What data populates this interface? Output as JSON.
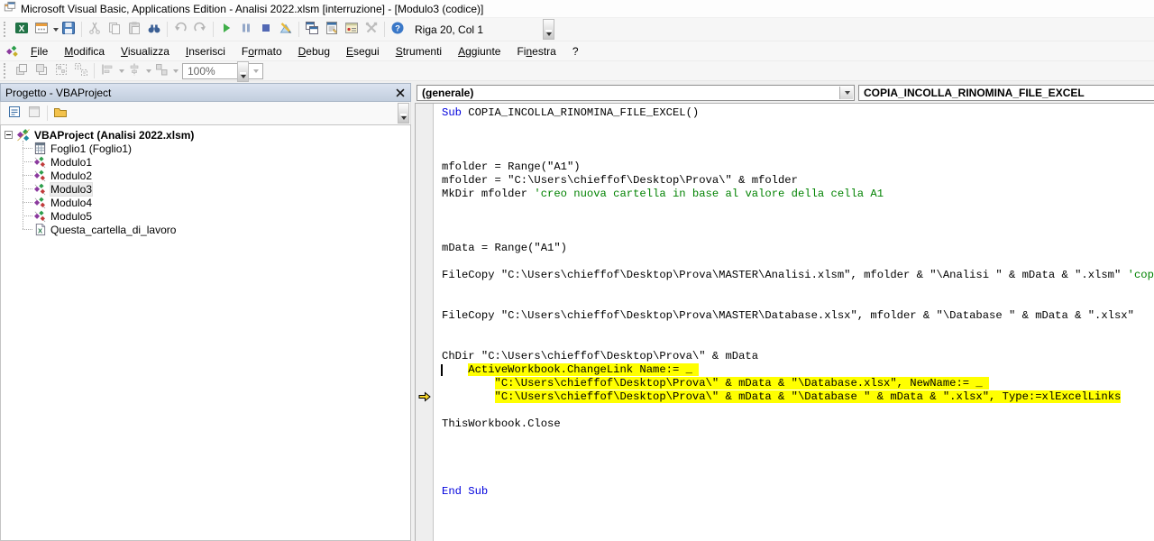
{
  "window": {
    "title": "Microsoft Visual Basic, Applications Edition - Analisi 2022.xlsm [interruzione] - [Modulo3 (codice)]"
  },
  "toolbar_main": {
    "position_status": "Riga 20, Col 1",
    "buttons": [
      {
        "name": "view-excel-button",
        "icon": "excel",
        "enabled": true
      },
      {
        "name": "insert-userform-button",
        "icon": "userform",
        "enabled": true,
        "dropdown": true
      },
      {
        "name": "save-button",
        "icon": "save",
        "enabled": true
      },
      {
        "sep": true
      },
      {
        "name": "cut-button",
        "icon": "cut",
        "enabled": false
      },
      {
        "name": "copy-button",
        "icon": "copy",
        "enabled": false
      },
      {
        "name": "paste-button",
        "icon": "paste",
        "enabled": false
      },
      {
        "name": "find-button",
        "icon": "find",
        "enabled": true
      },
      {
        "sep": true
      },
      {
        "name": "undo-button",
        "icon": "undo",
        "enabled": false
      },
      {
        "name": "redo-button",
        "icon": "redo",
        "enabled": false
      },
      {
        "sep": true
      },
      {
        "name": "run-button",
        "icon": "run",
        "enabled": true
      },
      {
        "name": "break-button",
        "icon": "pause",
        "enabled": true
      },
      {
        "name": "reset-button",
        "icon": "stop",
        "enabled": true
      },
      {
        "name": "design-mode-button",
        "icon": "design",
        "enabled": true
      },
      {
        "sep": true
      },
      {
        "name": "project-explorer-button",
        "icon": "projexp",
        "enabled": true
      },
      {
        "name": "properties-window-button",
        "icon": "props",
        "enabled": true
      },
      {
        "name": "object-browser-button",
        "icon": "objbrowser",
        "enabled": true
      },
      {
        "name": "toolbox-button",
        "icon": "toolbox",
        "enabled": false
      },
      {
        "sep": true
      },
      {
        "name": "help-button",
        "icon": "help",
        "enabled": true
      }
    ]
  },
  "menubar": {
    "items": [
      {
        "label": "File",
        "accel": 0
      },
      {
        "label": "Modifica",
        "accel": 0
      },
      {
        "label": "Visualizza",
        "accel": 0
      },
      {
        "label": "Inserisci",
        "accel": 0
      },
      {
        "label": "Formato",
        "accel": 1
      },
      {
        "label": "Debug",
        "accel": 0
      },
      {
        "label": "Esegui",
        "accel": 0
      },
      {
        "label": "Strumenti",
        "accel": 0
      },
      {
        "label": "Aggiunte",
        "accel": 0
      },
      {
        "label": "Finestra",
        "accel": 2
      },
      {
        "label": "?",
        "accel": -1
      }
    ]
  },
  "toolbar_userform": {
    "zoom_value": "100%",
    "buttons": [
      {
        "name": "bring-to-front-button",
        "icon": "bringfront",
        "enabled": false
      },
      {
        "name": "send-to-back-button",
        "icon": "sendback",
        "enabled": false
      },
      {
        "name": "group-button",
        "icon": "group",
        "enabled": false
      },
      {
        "name": "ungroup-button",
        "icon": "ungroup",
        "enabled": false
      },
      {
        "sep": true
      },
      {
        "name": "align-button",
        "icon": "align",
        "enabled": false,
        "dropdown": true
      },
      {
        "name": "center-button",
        "icon": "centerh",
        "enabled": false,
        "dropdown": true
      },
      {
        "name": "make-same-size-button",
        "icon": "samesize",
        "enabled": false,
        "dropdown": true
      }
    ]
  },
  "project_panel": {
    "title": "Progetto - VBAProject",
    "toolbar": [
      {
        "name": "view-code-button",
        "icon": "viewcode",
        "enabled": true
      },
      {
        "name": "view-object-button",
        "icon": "viewobject",
        "enabled": false
      },
      {
        "sep": true
      },
      {
        "name": "toggle-folders-button",
        "icon": "folder",
        "enabled": true
      }
    ],
    "tree": {
      "root": {
        "label": "VBAProject (Analisi 2022.xlsm)",
        "icon": "vbaproj",
        "expanded": true
      },
      "children": [
        {
          "label": "Foglio1 (Foglio1)",
          "icon": "worksheet",
          "selected": false
        },
        {
          "label": "Modulo1",
          "icon": "module",
          "selected": false
        },
        {
          "label": "Modulo2",
          "icon": "module",
          "selected": false
        },
        {
          "label": "Modulo3",
          "icon": "module",
          "selected": true
        },
        {
          "label": "Modulo4",
          "icon": "module",
          "selected": false
        },
        {
          "label": "Modulo5",
          "icon": "module",
          "selected": false
        },
        {
          "label": "Questa_cartella_di_lavoro",
          "icon": "workbook",
          "selected": false
        }
      ]
    }
  },
  "code_window": {
    "object_combo": "(generale)",
    "procedure_combo": "COPIA_INCOLLA_RINOMINA_FILE_EXCEL",
    "caret": {
      "row": 20,
      "col": 1
    },
    "execution_arrow_row": 22,
    "total_rows": 32,
    "colors": {
      "keyword": "#0000dd",
      "comment": "#008200",
      "highlight": "#ffff00"
    },
    "lines": [
      {
        "row": 1,
        "seg": [
          {
            "t": "Sub",
            "k": "kw"
          },
          {
            "t": " COPIA_INCOLLA_RINOMINA_FILE_EXCEL()"
          }
        ]
      },
      {
        "row": 5,
        "seg": [
          {
            "t": "mfolder = Range(\"A1\")"
          }
        ]
      },
      {
        "row": 6,
        "seg": [
          {
            "t": "mfolder = \"C:\\Users\\chieffof\\Desktop\\Prova\\\" & mfolder"
          }
        ]
      },
      {
        "row": 7,
        "seg": [
          {
            "t": "MkDir mfolder "
          },
          {
            "t": "'creo nuova cartella in base al valore della cella A1",
            "k": "cmt"
          }
        ]
      },
      {
        "row": 11,
        "seg": [
          {
            "t": "mData = Range(\"A1\")"
          }
        ]
      },
      {
        "row": 13,
        "seg": [
          {
            "t": "FileCopy \"C:\\Users\\chieffof\\Desktop\\Prova\\MASTER\\Analisi.xlsm\", mfolder & \"\\Analisi \" & mData & \".xlsm\" "
          },
          {
            "t": "'copia e rinomina il file",
            "k": "cmt"
          }
        ]
      },
      {
        "row": 16,
        "seg": [
          {
            "t": "FileCopy \"C:\\Users\\chieffof\\Desktop\\Prova\\MASTER\\Database.xlsx\", mfolder & \"\\Database \" & mData & \".xlsx\""
          }
        ]
      },
      {
        "row": 19,
        "seg": [
          {
            "t": "ChDir \"C:\\Users\\chieffof\\Desktop\\Prova\\\" & mData"
          }
        ]
      },
      {
        "row": 20,
        "seg": [
          {
            "t": "    "
          },
          {
            "t": "ActiveWorkbook.ChangeLink Name:= _ ",
            "hl": true
          }
        ]
      },
      {
        "row": 21,
        "seg": [
          {
            "t": "        "
          },
          {
            "t": "\"C:\\Users\\chieffof\\Desktop\\Prova\\\" & mData & \"\\Database.xlsx\", NewName:= _ ",
            "hl": true
          }
        ]
      },
      {
        "row": 22,
        "seg": [
          {
            "t": "        "
          },
          {
            "t": "\"C:\\Users\\chieffof\\Desktop\\Prova\\\" & mData & \"\\Database \" & mData & \".xlsx\", Type:=xlExcelLinks",
            "hl": true
          }
        ]
      },
      {
        "row": 24,
        "seg": [
          {
            "t": "ThisWorkbook.Close"
          }
        ]
      },
      {
        "row": 29,
        "seg": [
          {
            "t": "End Sub",
            "k": "kw"
          }
        ]
      }
    ]
  }
}
